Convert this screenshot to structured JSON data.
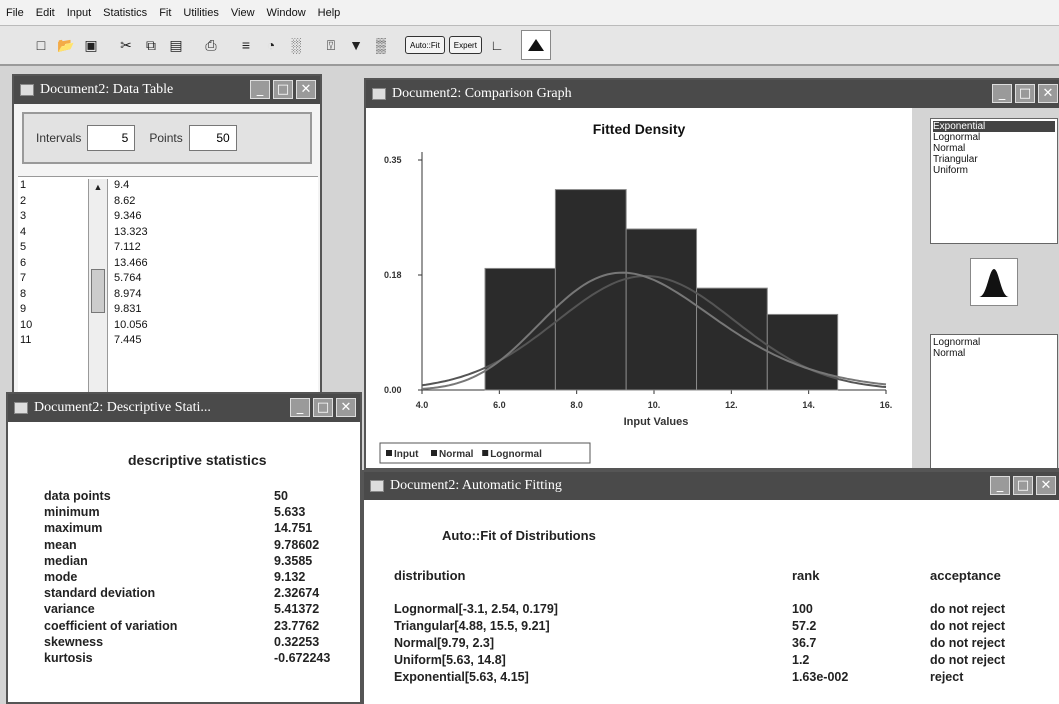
{
  "menu": [
    "File",
    "Edit",
    "Input",
    "Statistics",
    "Fit",
    "Utilities",
    "View",
    "Window",
    "Help"
  ],
  "toolbar": {
    "buttons": [
      "new-icon",
      "open-icon",
      "save-icon",
      "cut-icon",
      "copy-icon",
      "paste-icon",
      "print-icon",
      "stats-icon",
      "pie-icon",
      "histogram-icon",
      "fit-icon",
      "filter-icon",
      "compare-icon"
    ],
    "pill1": "Auto::Fit",
    "pill2": "Expert",
    "active_icon": "density-icon"
  },
  "data_table": {
    "title": "Document2: Data Table",
    "intervals_label": "Intervals",
    "intervals_value": "5",
    "points_label": "Points",
    "points_value": "50",
    "rows": [
      {
        "n": "1",
        "v": "9.4"
      },
      {
        "n": "2",
        "v": "8.62"
      },
      {
        "n": "3",
        "v": "9.346"
      },
      {
        "n": "4",
        "v": "13.323"
      },
      {
        "n": "5",
        "v": "7.112"
      },
      {
        "n": "6",
        "v": "13.466"
      },
      {
        "n": "7",
        "v": "5.764"
      },
      {
        "n": "8",
        "v": "8.974"
      },
      {
        "n": "9",
        "v": "9.831"
      },
      {
        "n": "10",
        "v": "10.056"
      },
      {
        "n": "11",
        "v": "7.445"
      }
    ]
  },
  "stats": {
    "title": "Document2: Descriptive Stati...",
    "heading": "descriptive statistics",
    "items": [
      {
        "k": "data points",
        "v": "50"
      },
      {
        "k": "minimum",
        "v": "5.633"
      },
      {
        "k": "maximum",
        "v": "14.751"
      },
      {
        "k": "mean",
        "v": "9.78602"
      },
      {
        "k": "median",
        "v": "9.3585"
      },
      {
        "k": "mode",
        "v": "9.132"
      },
      {
        "k": "standard deviation",
        "v": "2.32674"
      },
      {
        "k": "variance",
        "v": "5.41372"
      },
      {
        "k": "coefficient of variation",
        "v": "23.7762"
      },
      {
        "k": "skewness",
        "v": "0.32253"
      },
      {
        "k": "kurtosis",
        "v": "-0.672243"
      }
    ]
  },
  "graph": {
    "title": "Document2: Comparison Graph",
    "dist_list_top": [
      "Exponential",
      "Lognormal",
      "Normal",
      "Triangular",
      "Uniform"
    ],
    "selected_top": "Exponential",
    "dist_list_bottom": [
      "Lognormal",
      "Normal"
    ]
  },
  "chart_data": {
    "type": "bar",
    "title": "Fitted Density",
    "xlabel": "Input Values",
    "ylabel": "",
    "xlim": [
      4.0,
      16.0
    ],
    "ylim": [
      0.0,
      0.35
    ],
    "x_ticks": [
      "4.0",
      "6.0",
      "8.0",
      "10.",
      "12.",
      "14.",
      "16."
    ],
    "y_ticks": [
      "0.00",
      "0.18",
      "0.35"
    ],
    "bins": [
      {
        "x0": 5.63,
        "x1": 7.45,
        "value": 0.185
      },
      {
        "x0": 7.45,
        "x1": 9.28,
        "value": 0.305
      },
      {
        "x0": 9.28,
        "x1": 11.1,
        "value": 0.245
      },
      {
        "x0": 11.1,
        "x1": 12.93,
        "value": 0.155
      },
      {
        "x0": 12.93,
        "x1": 14.75,
        "value": 0.115
      }
    ],
    "series": [
      {
        "name": "Normal",
        "mean": 9.79,
        "sd": 2.3
      },
      {
        "name": "Lognormal",
        "params": [
          -3.1,
          2.54,
          0.179
        ]
      }
    ],
    "legend": [
      "Input",
      "Normal",
      "Lognormal"
    ],
    "legend_position": "bottom-left",
    "colors": {
      "bars": "#2b2b2b",
      "curve": "#555555",
      "axis": "#333333"
    }
  },
  "fit": {
    "title": "Document2: Automatic Fitting",
    "heading": "Auto::Fit of Distributions",
    "headers": [
      "distribution",
      "rank",
      "acceptance"
    ],
    "rows": [
      {
        "d": "Lognormal[-3.1, 2.54, 0.179]",
        "r": "100",
        "a": "do not reject"
      },
      {
        "d": "Triangular[4.88, 15.5, 9.21]",
        "r": "57.2",
        "a": "do not reject"
      },
      {
        "d": "Normal[9.79, 2.3]",
        "r": "36.7",
        "a": "do not reject"
      },
      {
        "d": "Uniform[5.63, 14.8]",
        "r": "1.2",
        "a": "do not reject"
      },
      {
        "d": "Exponential[5.63, 4.15]",
        "r": "1.63e-002",
        "a": "reject"
      }
    ]
  }
}
